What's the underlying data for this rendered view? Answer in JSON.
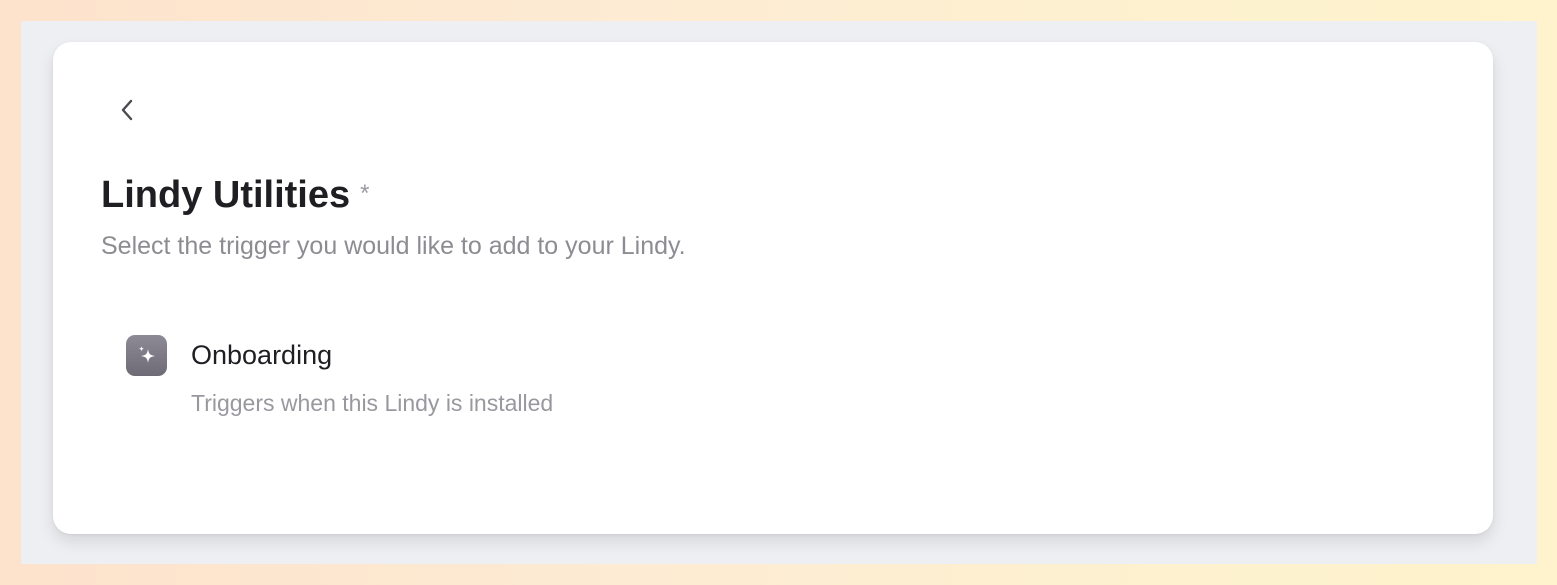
{
  "header": {
    "title": "Lindy Utilities",
    "required_marker": "*",
    "subtitle": "Select the trigger you would like to add to your Lindy."
  },
  "navigation": {
    "back_icon": "chevron-left-icon"
  },
  "triggers": [
    {
      "name": "Onboarding",
      "description": "Triggers when this Lindy is installed",
      "icon": "sparkle-icon"
    }
  ],
  "colors": {
    "card_background": "#ffffff",
    "frame_background": "#eeeff2",
    "title_text": "#1f1f23",
    "muted_text": "#8c8c92",
    "icon_background": "#7c7985"
  }
}
